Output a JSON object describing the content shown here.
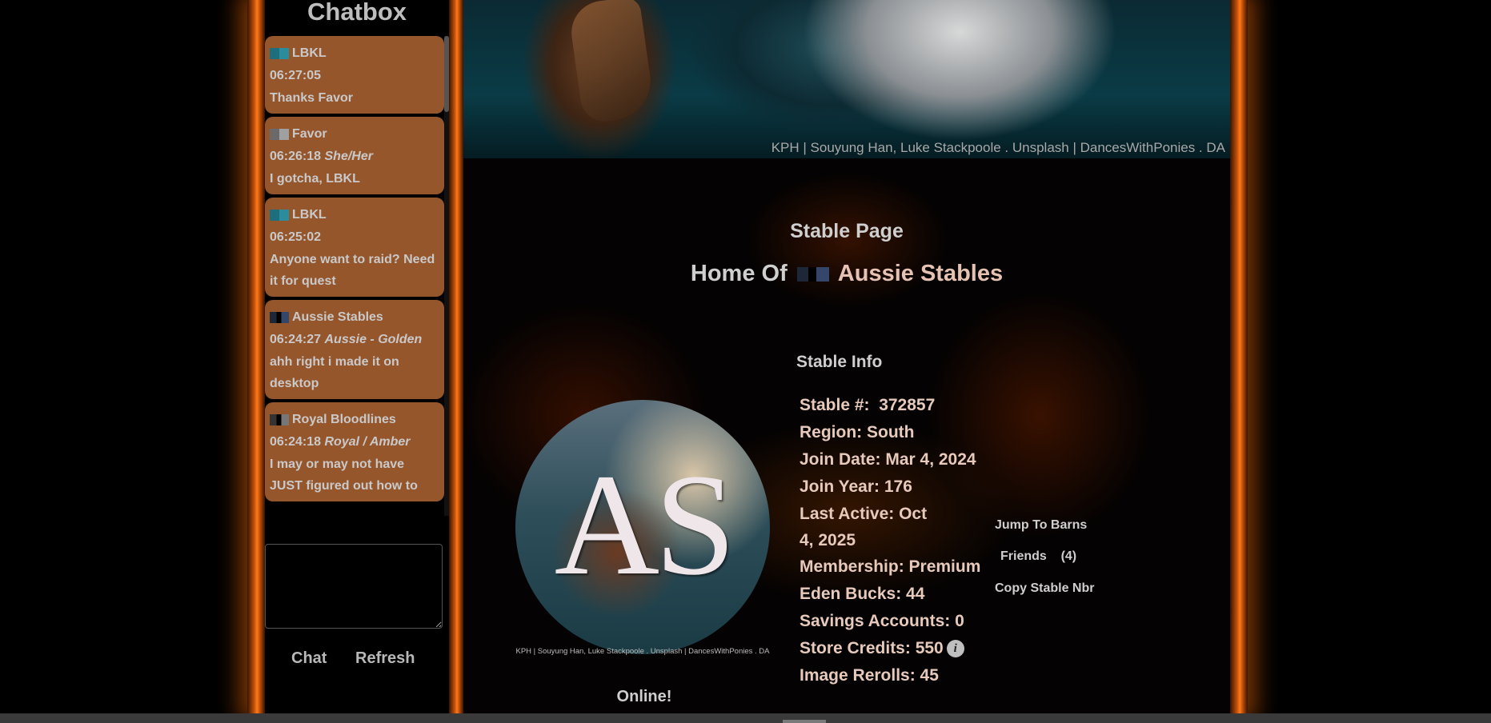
{
  "chatbox": {
    "title": "Chatbox",
    "messages": [
      {
        "name": "LBKL",
        "time": "06:27:05",
        "pronouns": "",
        "text": "Thanks Favor",
        "flag": "#1d6f7d"
      },
      {
        "name": "Favor",
        "time": "06:26:18",
        "pronouns": "She/Her",
        "text": "I gotcha, LBKL",
        "flag": "#8a8a8a"
      },
      {
        "name": "LBKL",
        "time": "06:25:02",
        "pronouns": "",
        "text": "Anyone want to raid? Need it for quest",
        "flag": "#1d6f7d"
      },
      {
        "name": "Aussie Stables",
        "time": "06:24:27",
        "pronouns": "Aussie - Golden",
        "text": "ahh right i made it on desktop",
        "flag": "#34476a"
      },
      {
        "name": "Royal Bloodlines",
        "time": "06:24:18",
        "pronouns": "Royal / Amber",
        "text": "I may or may not have JUST figured out how to",
        "flag": "#555555"
      }
    ],
    "chat_button": "Chat",
    "refresh_button": "Refresh"
  },
  "banner": {
    "credit": "KPH | Souyung Han, Luke Stackpoole . Unsplash | DancesWithPonies . DA"
  },
  "page": {
    "title": "Stable Page",
    "home_prefix": "Home Of",
    "stable_name": "Aussie Stables",
    "section_title": "Stable Info"
  },
  "logo": {
    "letters": "AS",
    "credit": "KPH | Souyung Han, Luke Stackpoole . Unsplash | DancesWithPonies . DA"
  },
  "status": "Online!",
  "stable_info": {
    "stable_number": "Stable #:  372857",
    "region": "Region: South",
    "join_date": "Join Date: Mar 4, 2024",
    "join_year": "Join Year: 176",
    "last_active": "Last Active: Oct 4, 2025",
    "membership": "Membership: Premium",
    "eden_bucks": "Eden Bucks: 44",
    "savings_accounts": "Savings Accounts: 0",
    "store_credits": "Store Credits: 550",
    "image_rerolls": "Image Rerolls: 45"
  },
  "links": {
    "jump_to_barns": "Jump To Barns",
    "friends": "Friends",
    "friends_count": "(4)",
    "copy_stable_nbr": "Copy Stable Nbr"
  },
  "colors": {
    "frame_orange": "#ff7a1a",
    "chat_bubble": "#96562c",
    "info_text": "#e7cabb"
  }
}
